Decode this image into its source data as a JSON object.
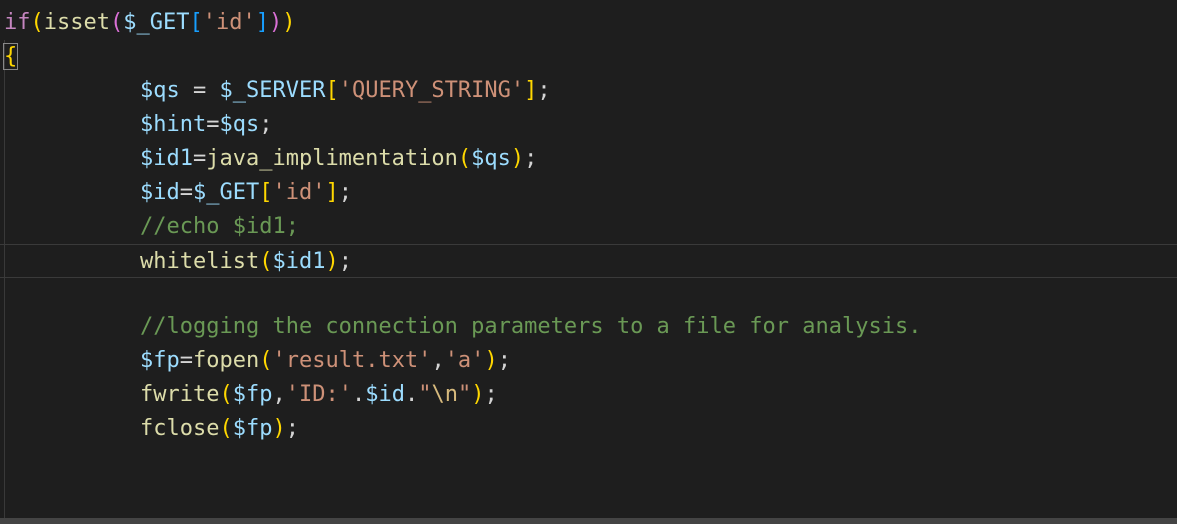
{
  "theme": {
    "background": "#1e1e1e",
    "keyword": "#c586c0",
    "function": "#dcdcaa",
    "variable": "#9cdcfe",
    "string": "#ce9178",
    "comment": "#6a9955",
    "escape": "#d7ba7d",
    "text": "#d4d4d4",
    "bracket_gold": "#ffd700",
    "bracket_purple": "#da70d6",
    "bracket_blue": "#179fff"
  },
  "code_lines": [
    {
      "tokens": [
        [
          "if",
          "keyword"
        ],
        [
          "(",
          "bracket_gold"
        ],
        [
          "isset",
          "function"
        ],
        [
          "(",
          "bracket_purple"
        ],
        [
          "$_GET",
          "variable"
        ],
        [
          "[",
          "bracket_blue"
        ],
        [
          "'id'",
          "string"
        ],
        [
          "]",
          "bracket_blue"
        ],
        [
          ")",
          "bracket_purple"
        ],
        [
          ")",
          "bracket_gold"
        ]
      ]
    },
    {
      "tokens": [
        [
          "{",
          "bracket_gold"
        ]
      ]
    },
    {
      "tokens": []
    },
    {
      "tokens": [
        [
          "$qs",
          "variable"
        ],
        [
          " = ",
          "text"
        ],
        [
          "$_SERVER",
          "variable"
        ],
        [
          "[",
          "bracket_gold"
        ],
        [
          "'QUERY_STRING'",
          "string"
        ],
        [
          "]",
          "bracket_gold"
        ],
        [
          ";",
          "text"
        ]
      ]
    },
    {
      "tokens": [
        [
          "$hint",
          "variable"
        ],
        [
          "=",
          "text"
        ],
        [
          "$qs",
          "variable"
        ],
        [
          ";",
          "text"
        ]
      ]
    },
    {
      "tokens": [
        [
          "$id1",
          "variable"
        ],
        [
          "=",
          "text"
        ],
        [
          "java_implimentation",
          "function"
        ],
        [
          "(",
          "bracket_gold"
        ],
        [
          "$qs",
          "variable"
        ],
        [
          ")",
          "bracket_gold"
        ],
        [
          ";",
          "text"
        ]
      ]
    },
    {
      "tokens": [
        [
          "$id",
          "variable"
        ],
        [
          "=",
          "text"
        ],
        [
          "$_GET",
          "variable"
        ],
        [
          "[",
          "bracket_gold"
        ],
        [
          "'id'",
          "string"
        ],
        [
          "]",
          "bracket_gold"
        ],
        [
          ";",
          "text"
        ]
      ]
    },
    {
      "tokens": [
        [
          "//echo $id1;",
          "comment"
        ]
      ]
    },
    {
      "tokens": [
        [
          "whitelist",
          "function"
        ],
        [
          "(",
          "bracket_gold"
        ],
        [
          "$id1",
          "variable"
        ],
        [
          ")",
          "bracket_gold"
        ],
        [
          ";",
          "text"
        ]
      ]
    },
    {
      "tokens": []
    },
    {
      "tokens": [
        [
          "//logging the connection parameters to a file for analysis.",
          "comment"
        ]
      ]
    },
    {
      "tokens": [
        [
          "$fp",
          "variable"
        ],
        [
          "=",
          "text"
        ],
        [
          "fopen",
          "function"
        ],
        [
          "(",
          "bracket_gold"
        ],
        [
          "'result.txt'",
          "string"
        ],
        [
          ",",
          "text"
        ],
        [
          "'a'",
          "string"
        ],
        [
          ")",
          "bracket_gold"
        ],
        [
          ";",
          "text"
        ]
      ]
    },
    {
      "tokens": [
        [
          "fwrite",
          "function"
        ],
        [
          "(",
          "bracket_gold"
        ],
        [
          "$fp",
          "variable"
        ],
        [
          ",",
          "text"
        ],
        [
          "'ID:'",
          "string"
        ],
        [
          ".",
          "text"
        ],
        [
          "$id",
          "variable"
        ],
        [
          ".",
          "text"
        ],
        [
          "\"",
          "string"
        ],
        [
          "\\n",
          "escape"
        ],
        [
          "\"",
          "string"
        ],
        [
          ")",
          "bracket_gold"
        ],
        [
          ";",
          "text"
        ]
      ]
    },
    {
      "tokens": [
        [
          "fclose",
          "function"
        ],
        [
          "(",
          "bracket_gold"
        ],
        [
          "$fp",
          "variable"
        ],
        [
          ")",
          "bracket_gold"
        ],
        [
          ";",
          "text"
        ]
      ]
    }
  ]
}
